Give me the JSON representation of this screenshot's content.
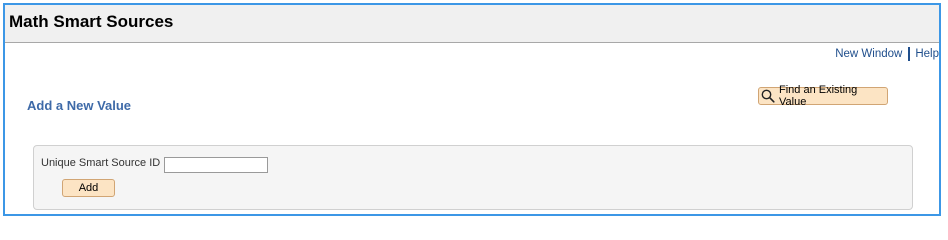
{
  "header": {
    "title": "Math Smart Sources"
  },
  "toplinks": {
    "new_window": "New Window",
    "help": "Help"
  },
  "section": {
    "title": "Add a New Value"
  },
  "find_button": {
    "label": "Find an Existing Value",
    "icon": "search-icon"
  },
  "form": {
    "field_label": "Unique Smart Source ID",
    "field_value": "",
    "add_label": "Add"
  },
  "colors": {
    "frame_border": "#3c97e6",
    "header_bg": "#f0f0f0",
    "link": "#1f4e8c",
    "section_title": "#3e6aa8",
    "button_bg": "#fce4c4",
    "button_border": "#d1a574",
    "group_bg": "#f5f5f5"
  }
}
